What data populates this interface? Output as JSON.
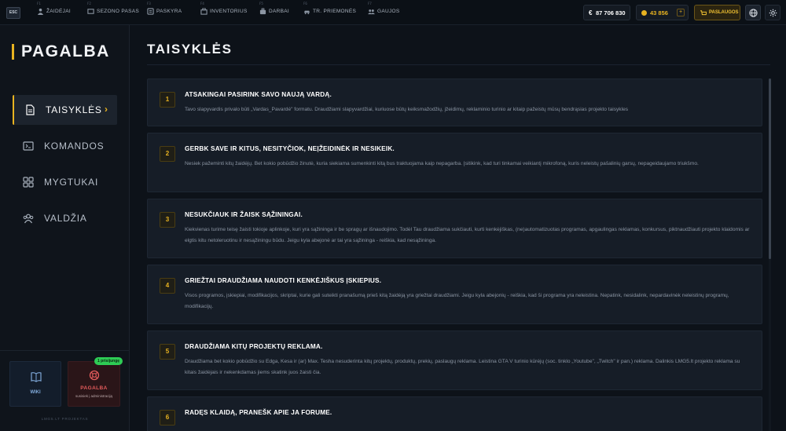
{
  "topbar": {
    "esc_label": "ESC",
    "nav": [
      {
        "key": "F1",
        "label": "ŽAIDĖJAI",
        "icon": "players-icon"
      },
      {
        "key": "F2",
        "label": "SEZONO PASAS",
        "icon": "season-pass-icon"
      },
      {
        "key": "F3",
        "label": "PASKYRA",
        "icon": "account-icon"
      },
      {
        "key": "F4",
        "label": "INVENTORIUS",
        "icon": "inventory-icon"
      },
      {
        "key": "F5",
        "label": "DARBAI",
        "icon": "jobs-icon"
      },
      {
        "key": "F6",
        "label": "TR. PRIEMONĖS",
        "icon": "vehicles-icon"
      },
      {
        "key": "F7",
        "label": "GAUJOS",
        "icon": "gangs-icon"
      }
    ],
    "cash": "87 706 830",
    "coins": "43 856",
    "coins_add": "+",
    "services_label": "PASLAUGOS",
    "colors": {
      "accent": "#e8b321",
      "cash": "#ffffff"
    }
  },
  "sidebar": {
    "title": "PAGALBA",
    "items": [
      {
        "label": "TAISYKLĖS",
        "icon": "document-icon",
        "active": true,
        "arrow": "›"
      },
      {
        "label": "KOMANDOS",
        "icon": "terminal-icon",
        "active": false
      },
      {
        "label": "MYGTUKAI",
        "icon": "grid-icon",
        "active": false
      },
      {
        "label": "VALDŽIA",
        "icon": "staff-icon",
        "active": false
      }
    ],
    "wiki_label": "WIKI",
    "help": {
      "label": "PAGALBA",
      "sub": "susisiek į administraciją",
      "badge": "1 prisijungę"
    },
    "footer": "LMG5.LT PROJEKTAS"
  },
  "main": {
    "title": "TAISYKLĖS",
    "rules": [
      {
        "num": "1",
        "title": "ATSAKINGAI PASIRINK SAVO NAUJĄ VARDĄ.",
        "text": "Tavo slapyvardis privalo būti „Vardas_Pavardė\" formatu. Draudžiami slapyvardžiai, kuriuose būtų keiksmažodžių, įžeidimų, reklaminio turinio ar kitaip pažeistų mūsų bendrąsias projekto taisykles"
      },
      {
        "num": "2",
        "title": "GERBK SAVE IR KITUS, NESITYČIOK, NEĮŽEIDINĖK IR NESIKEIK.",
        "text": "Nesiek pažeminti kitų žaidėjų. Bet kokio pobūdžio žinutė, kuria siekiama sumenkinti kitą bus traktuojama kaip nepagarba. Įsitikink, kad turi tinkamai veikiantį mikrofoną, kuris neleistų pašalinių garsų, nepageidaujamo triukšmo."
      },
      {
        "num": "3",
        "title": "NESUKČIAUK IR ŽAISK SĄŽININGAI.",
        "text": "Kiekvienas turime teisę žaisti tokioje aplinkoje, kuri yra sąžininga ir be spragų ar išnaudojimo. Todėl Tau draudžiama sukčiauti, kurti kenkėjiškas, (ne)automatizuotas programas, apgaulingas reklamas, konkursus, piktnaudžiauti projekto klaidomis ar elgtis kitu netoleruotinu ir nesąžiningu būdu. Jeigu kyla abejonė ar tai yra sąžininga - reiškia, kad nesąžininga."
      },
      {
        "num": "4",
        "title": "GRIEŽTAI DRAUDŽIAMA NAUDOTI KENKĖJIŠKUS ĮSKIEPIUS.",
        "text": "Visos programos, įskiepiai, modifikacijos, skriptai, kurie gali suteikti pranašumą prieš kitą žaidėją yra griežtai draudžiami. Jeigu kyla abejonių - reiškia, kad ši programa yra neleistina. Nepatink, nesidalink, nepardavinėk neleistinų programų, modifikacijų."
      },
      {
        "num": "5",
        "title": "DRAUDŽIAMA KITŲ PROJEKTŲ REKLAMA.",
        "text": "Draudžiama bet kokio pobūdžio su Edga, Kesa ir (ar) Max. Tesha nesuderinta kitų projektų, produktų, prekių, paslaugų reklama. Leistina GTA V turinio kūrėjų (soc. tinklo „Youtube\", „Twitch\" ir pan.) reklama. Dalinkis LMG5.lt projekto reklama su kitais žaidėjais ir nekenkdamas jiems skatink juos žaisti čia."
      },
      {
        "num": "6",
        "title": "RADĘS KLAIDĄ, PRANEŠK APIE JA FORUME.",
        "text": ""
      }
    ]
  }
}
